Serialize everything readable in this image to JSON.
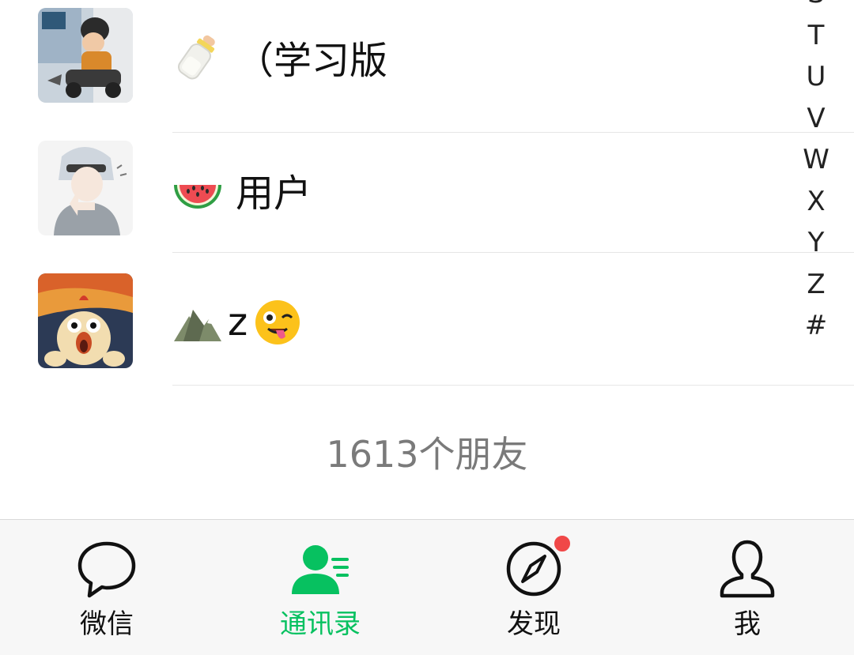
{
  "contacts": [
    {
      "name": "（学习版",
      "emoji": "baby-bottle-icon",
      "avatar": "baby-on-toy-car-photo"
    },
    {
      "name": "用户",
      "emoji": "watermelon-icon",
      "avatar": "anime-boy-gray-hoodie"
    },
    {
      "name": "z",
      "emoji_before": "mountain-icon",
      "emoji_after": "winking-tongue-face-icon",
      "avatar": "screaming-chicken-painting"
    }
  ],
  "index_bar": [
    "S",
    "T",
    "U",
    "V",
    "W",
    "X",
    "Y",
    "Z",
    "#"
  ],
  "friend_count": "1613个朋友",
  "tabbar": {
    "tabs": [
      {
        "label": "微信",
        "icon": "chat-bubble-icon",
        "active": false
      },
      {
        "label": "通讯录",
        "icon": "contacts-icon",
        "active": true
      },
      {
        "label": "发现",
        "icon": "compass-icon",
        "active": false,
        "badge": "red-dot"
      },
      {
        "label": "我",
        "icon": "person-icon",
        "active": false
      }
    ]
  },
  "colors": {
    "accent": "#07c160",
    "badge": "#f04848",
    "tabbar_bg": "#f7f7f7",
    "count_text": "#7a7a7a"
  }
}
